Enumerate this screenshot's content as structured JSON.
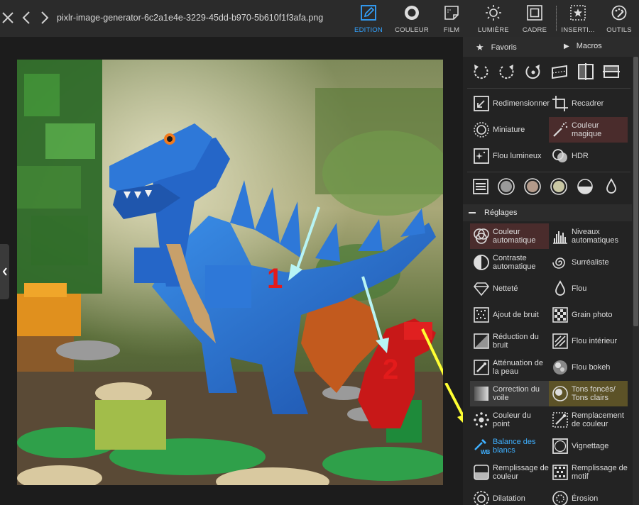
{
  "window": {
    "filename": "pixlr-image-generator-6c2a1e4e-3229-45dd-b970-5b610f1f3afa.png"
  },
  "toolbar": {
    "tools": [
      {
        "label": "EDITION",
        "icon": "edit-icon",
        "active": true
      },
      {
        "label": "COULEUR",
        "icon": "color-icon",
        "active": false
      },
      {
        "label": "FILM",
        "icon": "film-icon",
        "active": false
      },
      {
        "label": "LUMIÈRE",
        "icon": "light-icon",
        "active": false
      },
      {
        "label": "CADRE",
        "icon": "frame-icon",
        "active": false
      },
      {
        "label": "INSERTI...",
        "icon": "insert-icon",
        "active": false
      },
      {
        "label": "OUTILS",
        "icon": "tools-icon",
        "active": false
      }
    ],
    "accent": "#33a3ff"
  },
  "panel": {
    "favoris": "Favoris",
    "macros": "Macros",
    "tools_top": [
      {
        "label": "Redimensionner",
        "icon": "resize-icon"
      },
      {
        "label": "Recadrer",
        "icon": "crop-icon"
      },
      {
        "label": "Miniature",
        "icon": "miniature-icon"
      },
      {
        "label": "Couleur magique",
        "icon": "magic-wand-icon"
      },
      {
        "label": "Flou lumineux",
        "icon": "glow-icon"
      },
      {
        "label": "HDR",
        "icon": "hdr-icon"
      }
    ],
    "section_title": "Réglages",
    "adjustments": [
      {
        "label": "Couleur automatique",
        "icon": "auto-color-icon"
      },
      {
        "label": "Niveaux automatiques",
        "icon": "auto-levels-icon"
      },
      {
        "label": "Contraste automatique",
        "icon": "auto-contrast-icon"
      },
      {
        "label": "Surréaliste",
        "icon": "surreal-icon"
      },
      {
        "label": "Netteté",
        "icon": "sharpen-icon"
      },
      {
        "label": "Flou",
        "icon": "blur-drop-icon"
      },
      {
        "label": "Ajout de bruit",
        "icon": "add-noise-icon"
      },
      {
        "label": "Grain photo",
        "icon": "grain-icon"
      },
      {
        "label": "Réduction du bruit",
        "icon": "noise-reduction-icon"
      },
      {
        "label": "Flou intérieur",
        "icon": "inner-blur-icon"
      },
      {
        "label": "Atténuation de la peau",
        "icon": "skin-soften-icon"
      },
      {
        "label": "Flou bokeh",
        "icon": "bokeh-icon"
      },
      {
        "label": "Correction du voile",
        "icon": "dehaze-icon"
      },
      {
        "label": "Tons foncés/ Tons clairs",
        "icon": "shadows-highlights-icon"
      },
      {
        "label": "Couleur du point",
        "icon": "color-point-icon"
      },
      {
        "label": "Remplacement de couleur",
        "icon": "color-replace-icon"
      },
      {
        "label": "Balance des blancs",
        "icon": "white-balance-icon",
        "selected": true
      },
      {
        "label": "Vignettage",
        "icon": "vignette-icon"
      },
      {
        "label": "Remplissage de couleur",
        "icon": "color-fill-icon"
      },
      {
        "label": "Remplissage de motif",
        "icon": "pattern-fill-icon"
      },
      {
        "label": "Dilatation",
        "icon": "dilate-icon"
      },
      {
        "label": "Érosion",
        "icon": "erode-icon"
      }
    ]
  },
  "annotations": {
    "marker_1": "1",
    "marker_2": "2",
    "marker_color": "#e31b1b",
    "arrow_cyan": "#b8f4f4",
    "arrow_yellow": "#ffff33"
  }
}
